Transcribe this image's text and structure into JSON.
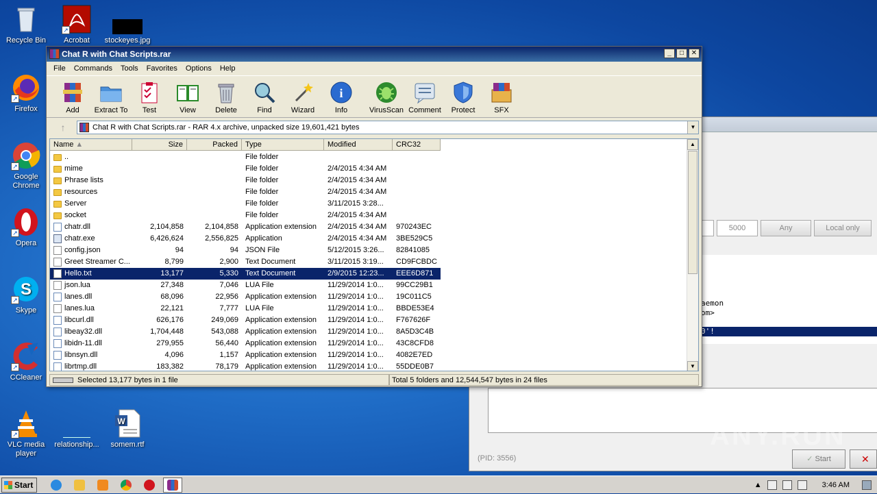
{
  "desktop": {
    "icons": [
      {
        "label": "Recycle Bin"
      },
      {
        "label": "Acrobat"
      },
      {
        "label": "stockeyes.jpg"
      },
      {
        "label": "Firefox"
      },
      {
        "label": "Google Chrome"
      },
      {
        "label": "Opera"
      },
      {
        "label": "Skype"
      },
      {
        "label": "CCleaner"
      },
      {
        "label": "VLC media player"
      },
      {
        "label": "relationship..."
      },
      {
        "label": "somem.rtf"
      }
    ]
  },
  "background_window": {
    "field_value": "5000",
    "any_button": "Any",
    "local_only_button": "Local only",
    "console_lines": [
      "aemon",
      "om>",
      "0'!"
    ],
    "pid_text": "(PID: 3556)",
    "start_button": "Start",
    "watermark": "ANY.RUN"
  },
  "winrar": {
    "title": "Chat R with Chat Scripts.rar",
    "menu": [
      "File",
      "Commands",
      "Tools",
      "Favorites",
      "Options",
      "Help"
    ],
    "toolbar": [
      {
        "label": "Add",
        "icon": "add-archive-icon"
      },
      {
        "label": "Extract To",
        "icon": "extract-folder-icon"
      },
      {
        "label": "Test",
        "icon": "test-clipboard-icon"
      },
      {
        "label": "View",
        "icon": "view-book-icon"
      },
      {
        "label": "Delete",
        "icon": "trash-icon"
      },
      {
        "label": "Find",
        "icon": "magnifier-icon"
      },
      {
        "label": "Wizard",
        "icon": "wand-icon"
      },
      {
        "label": "Info",
        "icon": "info-icon"
      },
      {
        "label": "VirusScan",
        "icon": "bug-icon"
      },
      {
        "label": "Comment",
        "icon": "comment-icon"
      },
      {
        "label": "Protect",
        "icon": "shield-icon"
      },
      {
        "label": "SFX",
        "icon": "sfx-box-icon"
      }
    ],
    "address": "Chat R with Chat Scripts.rar - RAR 4.x archive, unpacked size 19,601,421 bytes",
    "columns": [
      "Name",
      "Size",
      "Packed",
      "Type",
      "Modified",
      "CRC32"
    ],
    "rows": [
      {
        "name": "..",
        "size": "",
        "packed": "",
        "type": "File folder",
        "modified": "",
        "crc": "",
        "icon": "folder"
      },
      {
        "name": "mime",
        "size": "",
        "packed": "",
        "type": "File folder",
        "modified": "2/4/2015 4:34 AM",
        "crc": "",
        "icon": "folder"
      },
      {
        "name": "Phrase lists",
        "size": "",
        "packed": "",
        "type": "File folder",
        "modified": "2/4/2015 4:34 AM",
        "crc": "",
        "icon": "folder"
      },
      {
        "name": "resources",
        "size": "",
        "packed": "",
        "type": "File folder",
        "modified": "2/4/2015 4:34 AM",
        "crc": "",
        "icon": "folder"
      },
      {
        "name": "Server",
        "size": "",
        "packed": "",
        "type": "File folder",
        "modified": "3/11/2015 3:28...",
        "crc": "",
        "icon": "folder"
      },
      {
        "name": "socket",
        "size": "",
        "packed": "",
        "type": "File folder",
        "modified": "2/4/2015 4:34 AM",
        "crc": "",
        "icon": "folder"
      },
      {
        "name": "chatr.dll",
        "size": "2,104,858",
        "packed": "2,104,858",
        "type": "Application extension",
        "modified": "2/4/2015 4:34 AM",
        "crc": "970243EC",
        "icon": "dll"
      },
      {
        "name": "chatr.exe",
        "size": "6,426,624",
        "packed": "2,556,825",
        "type": "Application",
        "modified": "2/4/2015 4:34 AM",
        "crc": "3BE529C5",
        "icon": "exe"
      },
      {
        "name": "config.json",
        "size": "94",
        "packed": "94",
        "type": "JSON File",
        "modified": "5/12/2015 3:26...",
        "crc": "82841085",
        "icon": "doc"
      },
      {
        "name": "Greet Streamer C...",
        "size": "8,799",
        "packed": "2,900",
        "type": "Text Document",
        "modified": "3/11/2015 3:19...",
        "crc": "CD9FCBDC",
        "icon": "doc"
      },
      {
        "name": "Hello.txt",
        "size": "13,177",
        "packed": "5,330",
        "type": "Text Document",
        "modified": "2/9/2015 12:23...",
        "crc": "EEE6D871",
        "icon": "doc",
        "selected": true
      },
      {
        "name": "json.lua",
        "size": "27,348",
        "packed": "7,046",
        "type": "LUA File",
        "modified": "11/29/2014 1:0...",
        "crc": "99CC29B1",
        "icon": "doc"
      },
      {
        "name": "lanes.dll",
        "size": "68,096",
        "packed": "22,956",
        "type": "Application extension",
        "modified": "11/29/2014 1:0...",
        "crc": "19C011C5",
        "icon": "dll"
      },
      {
        "name": "lanes.lua",
        "size": "22,121",
        "packed": "7,777",
        "type": "LUA File",
        "modified": "11/29/2014 1:0...",
        "crc": "BBDE53E4",
        "icon": "doc"
      },
      {
        "name": "libcurl.dll",
        "size": "626,176",
        "packed": "249,069",
        "type": "Application extension",
        "modified": "11/29/2014 1:0...",
        "crc": "F767626F",
        "icon": "dll"
      },
      {
        "name": "libeay32.dll",
        "size": "1,704,448",
        "packed": "543,088",
        "type": "Application extension",
        "modified": "11/29/2014 1:0...",
        "crc": "8A5D3C4B",
        "icon": "dll"
      },
      {
        "name": "libidn-11.dll",
        "size": "279,955",
        "packed": "56,440",
        "type": "Application extension",
        "modified": "11/29/2014 1:0...",
        "crc": "43C8CFD8",
        "icon": "dll"
      },
      {
        "name": "libnsyn.dll",
        "size": "4,096",
        "packed": "1,157",
        "type": "Application extension",
        "modified": "11/29/2014 1:0...",
        "crc": "4082E7ED",
        "icon": "dll"
      },
      {
        "name": "librtmp.dll",
        "size": "183,382",
        "packed": "78,179",
        "type": "Application extension",
        "modified": "11/29/2014 1:0...",
        "crc": "55DDE0B7",
        "icon": "dll"
      }
    ],
    "status_left": "Selected 13,177 bytes in 1 file",
    "status_right": "Total 5 folders and 12,544,547 bytes in 24 files"
  },
  "taskbar": {
    "start_label": "Start",
    "clock": "3:46 AM"
  }
}
